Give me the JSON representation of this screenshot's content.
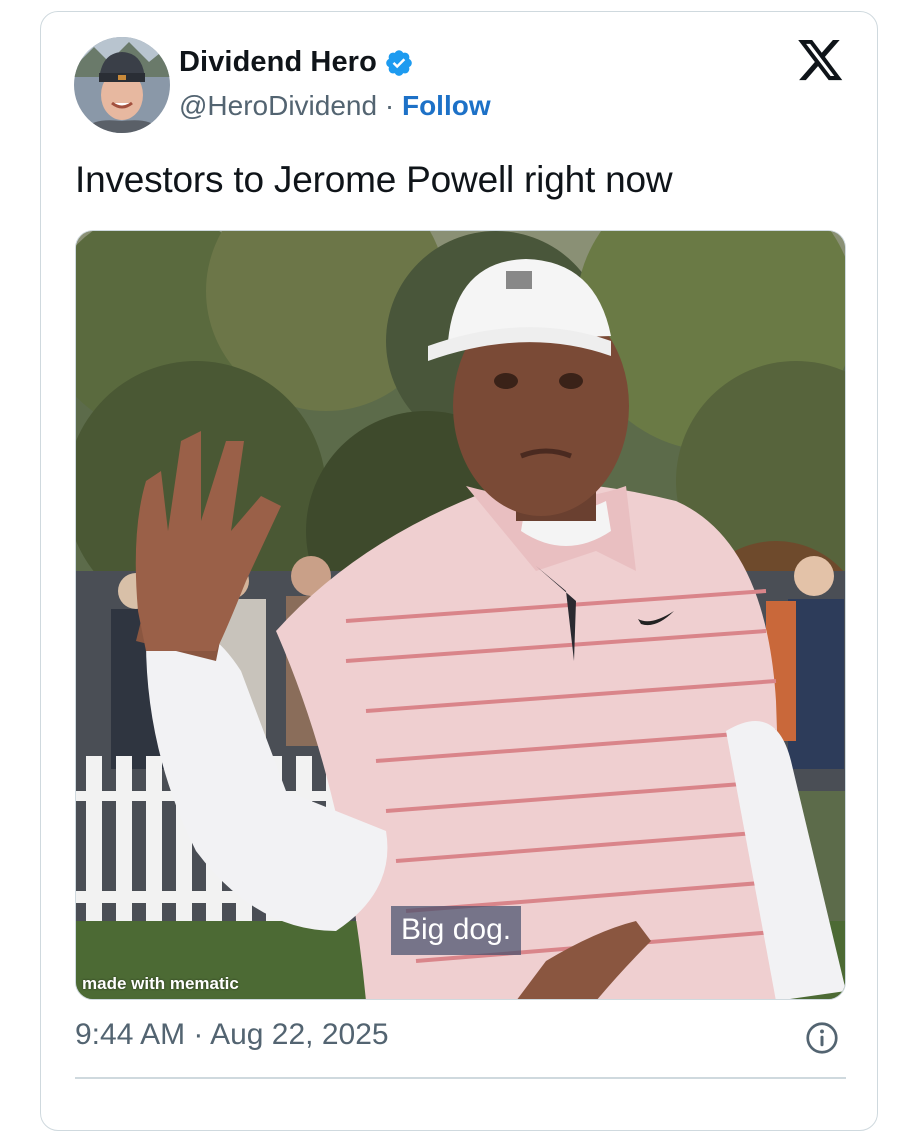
{
  "author": {
    "name": "Dividend Hero",
    "handle": "@HeroDividend",
    "separator": "·",
    "follow_label": "Follow",
    "verified": true,
    "avatar_icon": "user-avatar"
  },
  "platform_icon": "x-logo-icon",
  "tweet": {
    "text": "Investors to Jerome Powell right now",
    "timestamp": "9:44 AM · Aug 22, 2025"
  },
  "media": {
    "caption": "Big dog.",
    "watermark": "made with mematic"
  },
  "colors": {
    "accent": "#1d71c7",
    "verified_badge": "#1d9bf0",
    "text_primary": "#0f1419",
    "text_secondary": "#536471",
    "border": "#cfd9de"
  }
}
